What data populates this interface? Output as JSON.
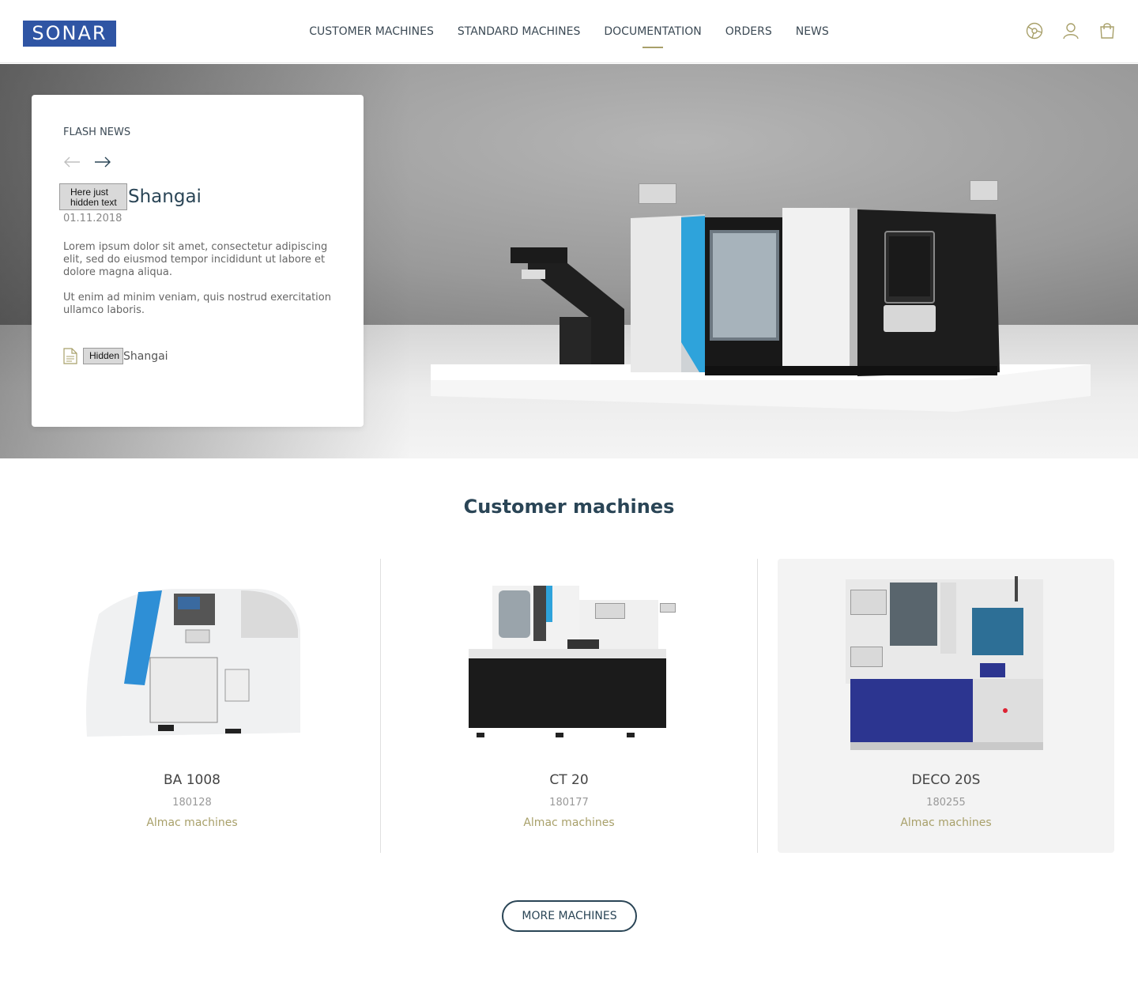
{
  "header": {
    "logo_text": "SONAR",
    "nav": [
      {
        "label": "CUSTOMER MACHINES"
      },
      {
        "label": "STANDARD MACHINES"
      },
      {
        "label": "DOCUMENTATION",
        "active": true
      },
      {
        "label": "ORDERS"
      },
      {
        "label": "NEWS"
      }
    ],
    "icons": [
      "steering-wheel-icon",
      "user-icon",
      "shopping-bag-icon"
    ],
    "accent_color": "#a8a06a",
    "brand_color": "#2f55a4"
  },
  "flash_news": {
    "label": "FLASH NEWS",
    "hidden_title_prefix": "Here just hidden text",
    "title": "Shangai",
    "date": "01.11.2018",
    "paragraph1": "Lorem ipsum dolor sit amet, consectetur adipiscing elit, sed do eiusmod tempor incididunt ut labore et dolore magna aliqua.",
    "paragraph2": "Ut enim ad minim veniam, quis nostrud exercitation ullamco laboris.",
    "attachment_hidden": "Hidden",
    "attachment_name": "Shangai"
  },
  "section": {
    "title": "Customer machines"
  },
  "products": [
    {
      "name": "BA 1008",
      "code": "180128",
      "brand": "Almac machines"
    },
    {
      "name": "CT 20",
      "code": "180177",
      "brand": "Almac machines"
    },
    {
      "name": "DECO 20S",
      "code": "180255",
      "brand": "Almac machines"
    }
  ],
  "more_button": "MORE MACHINES",
  "colors": {
    "title": "#2a4556",
    "machine_accent_blue": "#2ea3db",
    "deco_blue": "#2c3590"
  }
}
